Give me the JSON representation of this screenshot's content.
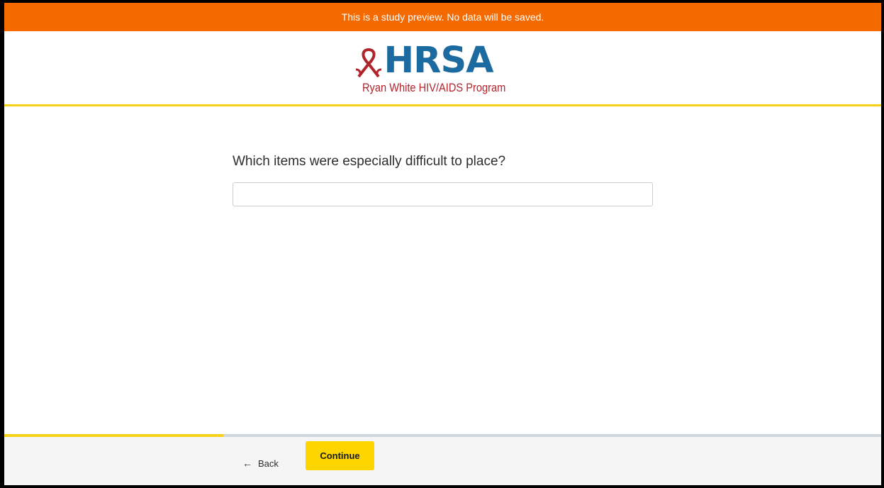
{
  "banner": {
    "text": "This is a study preview. No data will be saved."
  },
  "logo": {
    "icon": "awareness-ribbon-icon",
    "name": "HRSA",
    "subtitle": "Ryan White HIV/AIDS Program"
  },
  "question": {
    "text": "Which items were especially difficult to place?",
    "answer_value": "",
    "answer_placeholder": ""
  },
  "progress": {
    "fraction": 0.25
  },
  "footer": {
    "back_icon": "arrow-left-icon",
    "back_label": "Back",
    "continue_label": "Continue"
  },
  "colors": {
    "banner": "#f56a00",
    "accent": "#f7d117",
    "button": "#ffd500",
    "logo_blue": "#1b6aa0",
    "logo_red": "#b0242b"
  }
}
